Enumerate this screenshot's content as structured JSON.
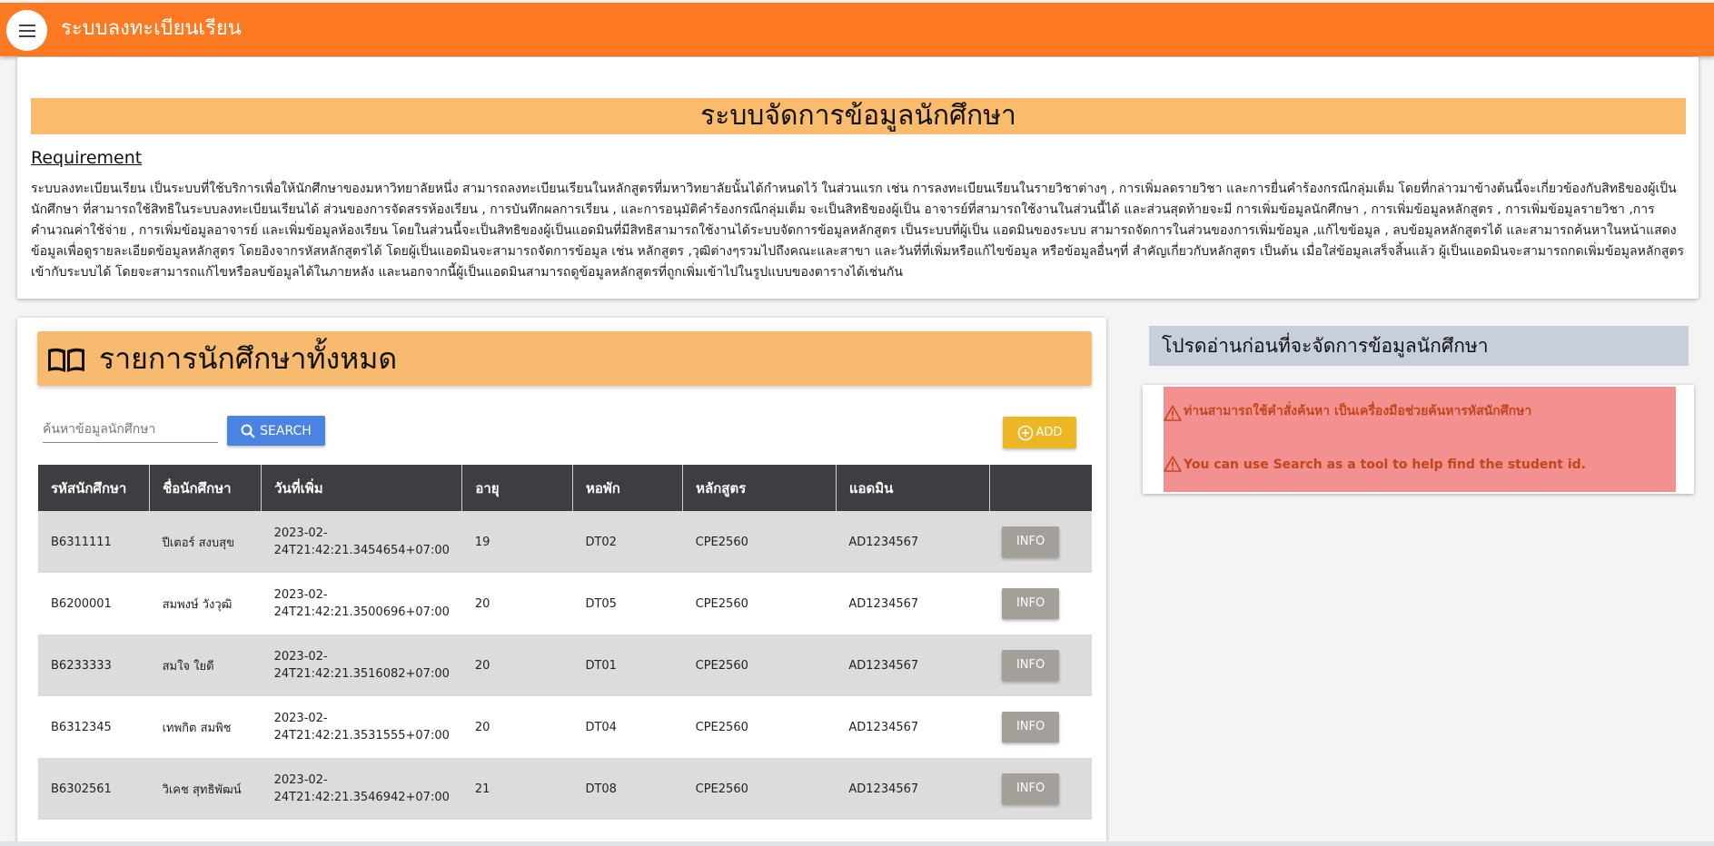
{
  "appbar": {
    "title": "ระบบลงทะเบียนเรียน"
  },
  "requirement": {
    "main_title": "ระบบจัดการข้อมูลนักศึกษา",
    "heading": "Requirement",
    "text": "ระบบลงทะเบียนเรียน เป็นระบบที่ใช้บริการเพื่อให้นักศึกษาของมหาวิทยาลัยหนึ่ง สามารถลงทะเบียนเรียนในหลักสูตรที่มหาวิทยาลัยนั้นได้กำหนดไว้ ในส่วนแรก เช่น การลงทะเบียนเรียนในรายวิชาต่างๆ , การเพิ่มลดรายวิชา และการยื่นคำร้องกรณีกลุ่มเต็ม โดยที่กล่าวมาข้างต้นนี้จะเกี่ยวข้องกับสิทธิของผู้เป็นนักศึกษา ที่สามารถใช้สิทธิในระบบลงทะเบียนเรียนได้ ส่วนของการจัดสรรห้องเรียน , การบันทึกผลการเรียน , และการอนุมัติคำร้องกรณีกลุ่มเต็ม จะเป็นสิทธิของผู้เป็น อาจารย์ที่สามารถใช้งานในส่วนนี้ได้ และส่วนสุดท้ายจะมี การเพิ่มข้อมูลนักศึกษา , การเพิ่มข้อมูลหลักสูตร , การเพิ่มข้อมูลรายวิชา ,การคำนวณค่าใช้จ่าย , การเพิ่มข้อมูลอาจารย์ และเพิ่มข้อมูลห้องเรียน โดยในส่วนนี้จะเป็นสิทธิของผู้เป็นแอดมินที่มีสิทธิสามารถใช้งานได้ระบบจัดการข้อมูลหลักสูตร เป็นระบบที่ผู้เป็น แอดมินของระบบ สามารถจัดการในส่วนของการเพิ่มข้อมูล ,แก้ไขข้อมูล , ลบข้อมูลหลักสูตรได้ และสามารถค้นหาในหน้าแสดงข้อมูลเพื่อดูรายละเอียดข้อมูลหลักสูตร โดยอิงจากรหัสหลักสูตรได้ โดยผู้เป็นแอดมินจะสามารถจัดการข้อมูล เช่น หลักสูตร ,วุฒิต่างๆรวมไปถึงคณะและสาขา และวันที่ที่เพิ่มหรือแก้ไขข้อมูล หรือข้อมูลอื่นๆที่ สำคัญเกี่ยวกับหลักสูตร เป็นต้น เมื่อใส่ข้อมูลเสร็จสิ้นแล้ว ผู้เป็นแอดมินจะสามารถกดเพิ่มข้อมูลหลักสูตรเข้ากับระบบได้ โดยจะสามารถแก้ไขหรือลบข้อมูลได้ในภายหลัง และนอกจากนี้ผู้เป็นแอดมินสามารถดูข้อมูลหลักสูตรที่ถูกเพิ่มเข้าไปในรูปแบบของตารางได้เช่นกัน"
  },
  "student_list": {
    "title": "รายการนักศึกษาทั้งหมด",
    "search_placeholder": "ค้นหาข้อมูลนักศึกษา",
    "search_label": "SEARCH",
    "add_label": "ADD",
    "columns": [
      "รหัสนักศึกษา",
      "ชื่อนักศึกษา",
      "วันที่เพิ่ม",
      "อายุ",
      "หอพัก",
      "หลักสูตร",
      "แอดมิน",
      ""
    ],
    "info_label": "INFO",
    "rows": [
      {
        "id": "B6311111",
        "name": "ปีเตอร์ สงบสุข",
        "date_1": "2023-02-",
        "date_2": "24T21:42:21.3454654+07:00",
        "age": "19",
        "dorm": "DT02",
        "course": "CPE2560",
        "admin": "AD1234567"
      },
      {
        "id": "B6200001",
        "name": "สมพงษ์ วังวุฒิ",
        "date_1": "2023-02-",
        "date_2": "24T21:42:21.3500696+07:00",
        "age": "20",
        "dorm": "DT05",
        "course": "CPE2560",
        "admin": "AD1234567"
      },
      {
        "id": "B6233333",
        "name": "สมใจ ใยดี",
        "date_1": "2023-02-",
        "date_2": "24T21:42:21.3516082+07:00",
        "age": "20",
        "dorm": "DT01",
        "course": "CPE2560",
        "admin": "AD1234567"
      },
      {
        "id": "B6312345",
        "name": "เทพกิต สมพิช",
        "date_1": "2023-02-",
        "date_2": "24T21:42:21.3531555+07:00",
        "age": "20",
        "dorm": "DT04",
        "course": "CPE2560",
        "admin": "AD1234567"
      },
      {
        "id": "B6302561",
        "name": "วิเคช สุทธิพัฒน์",
        "date_1": "2023-02-",
        "date_2": "24T21:42:21.3546942+07:00",
        "age": "21",
        "dorm": "DT08",
        "course": "CPE2560",
        "admin": "AD1234567"
      }
    ]
  },
  "side_panel": {
    "title": "โปรดอ่านก่อนที่จะจัดการข้อมูลนักศึกษา",
    "alert_th": "ท่านสามารถใช้คำสั่งค้นหา เป็นเครื่องมือช่วยค้นหารหัสนักศึกษา",
    "alert_en": "You can use Search as a tool to help find the student id."
  },
  "icons": {
    "menu": "menu-icon",
    "book": "book-icon",
    "search": "search-icon",
    "add": "plus-circle-icon",
    "warning": "warning-triangle-icon"
  },
  "colors": {
    "appbar": "#fd7a22",
    "title_bar": "#f9bb6c",
    "search_button": "#4b84e0",
    "add_button": "#ecb624",
    "info_button": "#a59f99",
    "table_header": "#3c3e42",
    "alert_bg": "#f39190",
    "alert_text": "#c2461a",
    "side_title_bg": "#c7cedc"
  }
}
